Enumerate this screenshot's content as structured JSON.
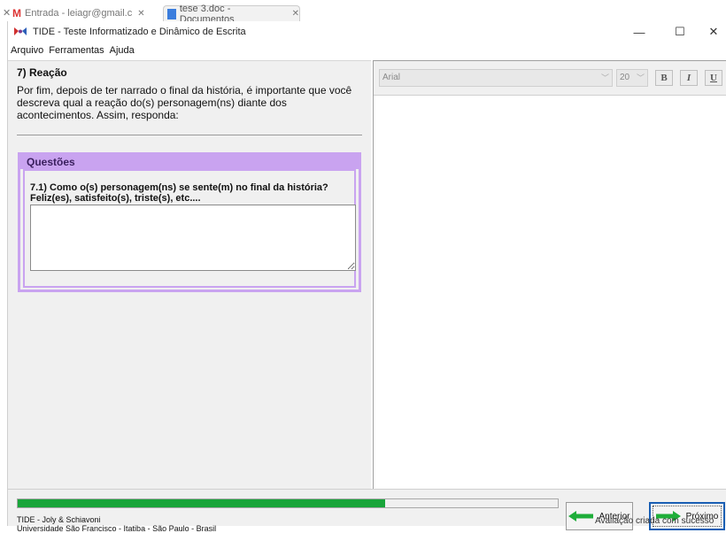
{
  "browser": {
    "tabs": [
      {
        "label": "Entrada - leiagr@gmail.c"
      },
      {
        "label": "tese 3.doc - Documentos"
      }
    ]
  },
  "window": {
    "title": "TIDE - Teste Informatizado e Dinâmico de Escrita",
    "controls": {
      "minimize": "—",
      "maximize": "☐",
      "close": "✕"
    }
  },
  "menu": {
    "items": [
      {
        "label": "Arquivo"
      },
      {
        "label": "Ferramentas"
      },
      {
        "label": "Ajuda"
      }
    ]
  },
  "section": {
    "title": "7) Reação",
    "description": "Por fim, depois de ter narrado o final da história, é importante que você descreva qual a reação do(s) personagem(ns) diante dos acontecimentos. Assim, responda:"
  },
  "questions": {
    "title": "Questões",
    "items": [
      {
        "text": "7.1) Como o(s) personagem(ns) se sente(m) no final da história? Feliz(es), satisfeito(s), triste(s), etc....",
        "answer": ""
      }
    ]
  },
  "editor": {
    "font": "Arial",
    "size": "20",
    "bold_label": "B",
    "italic_label": "I",
    "underline_label": "U"
  },
  "footer": {
    "progress": 0.68,
    "credits_line1": "TIDE - Joly & Schiavoni",
    "credits_line2": "Universidade São Francisco - Itatiba - São Paulo - Brasil",
    "prev_label": "Anterior",
    "next_label": "Próximo",
    "notification": "Avaliação criada com sucesso"
  },
  "colors": {
    "accent_purple": "#c9a3f0",
    "progress_green": "#19a53a",
    "arrow_green": "#1fae3a",
    "focus_blue": "#1a5fb4"
  }
}
